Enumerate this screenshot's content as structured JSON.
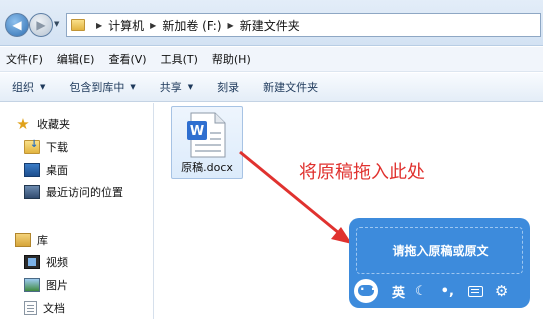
{
  "address": {
    "breadcrumbs": [
      "计算机",
      "新加卷 (F:)",
      "新建文件夹"
    ]
  },
  "menu": {
    "items": [
      "文件(F)",
      "编辑(E)",
      "查看(V)",
      "工具(T)",
      "帮助(H)"
    ]
  },
  "toolbar": {
    "organize": "组织",
    "include_library": "包含到库中",
    "share": "共享",
    "burn": "刻录",
    "new_folder": "新建文件夹"
  },
  "nav": {
    "favorites": "收藏夹",
    "downloads": "下载",
    "desktop": "桌面",
    "recent": "最近访问的位置",
    "libraries": "库",
    "videos": "视频",
    "pictures": "图片",
    "documents": "文档"
  },
  "file": {
    "name": "原稿.docx",
    "icon_letter": "W",
    "icon": "wps-writer-document-icon"
  },
  "annotation": {
    "text": "将原稿拖入此处",
    "color": "#e0322f"
  },
  "ime": {
    "prompt": "请拖入原稿或原文",
    "lang": "英",
    "accent": "#3d8bdc"
  }
}
